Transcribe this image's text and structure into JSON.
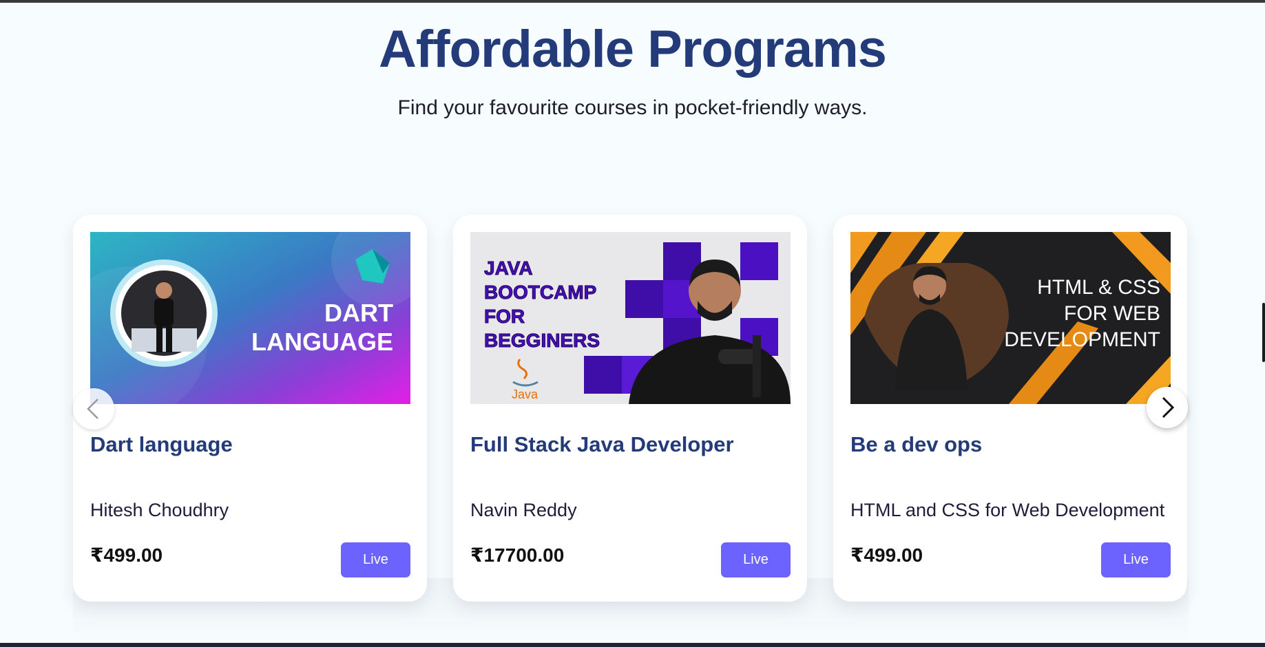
{
  "page": {
    "title": "Affordable Programs",
    "subtitle": "Find your favourite courses in pocket-friendly ways."
  },
  "carousel": {
    "prev_icon": "chevron-left-icon",
    "next_icon": "chevron-right-icon",
    "cards": [
      {
        "thumbnail_text": [
          "DART",
          "LANGUAGE"
        ],
        "title": "Dart language",
        "author": "Hitesh Choudhry",
        "price": "₹499.00",
        "button_label": "Live"
      },
      {
        "thumbnail_text": [
          "JAVA",
          "BOOTCAMP",
          "FOR",
          "BEGGINERS"
        ],
        "thumbnail_logo_text": "Java",
        "title": "Full Stack Java Developer",
        "author": "Navin Reddy",
        "price": "₹17700.00",
        "button_label": "Live"
      },
      {
        "thumbnail_text": [
          "HTML & CSS",
          "FOR WEB",
          "DEVELOPMENT"
        ],
        "title": "Be a dev ops",
        "author": "HTML and CSS for Web Development",
        "price": "₹499.00",
        "button_label": "Live"
      }
    ]
  },
  "colors": {
    "heading": "#243b7a",
    "button": "#6c63ff",
    "background": "#f7fcfe"
  }
}
